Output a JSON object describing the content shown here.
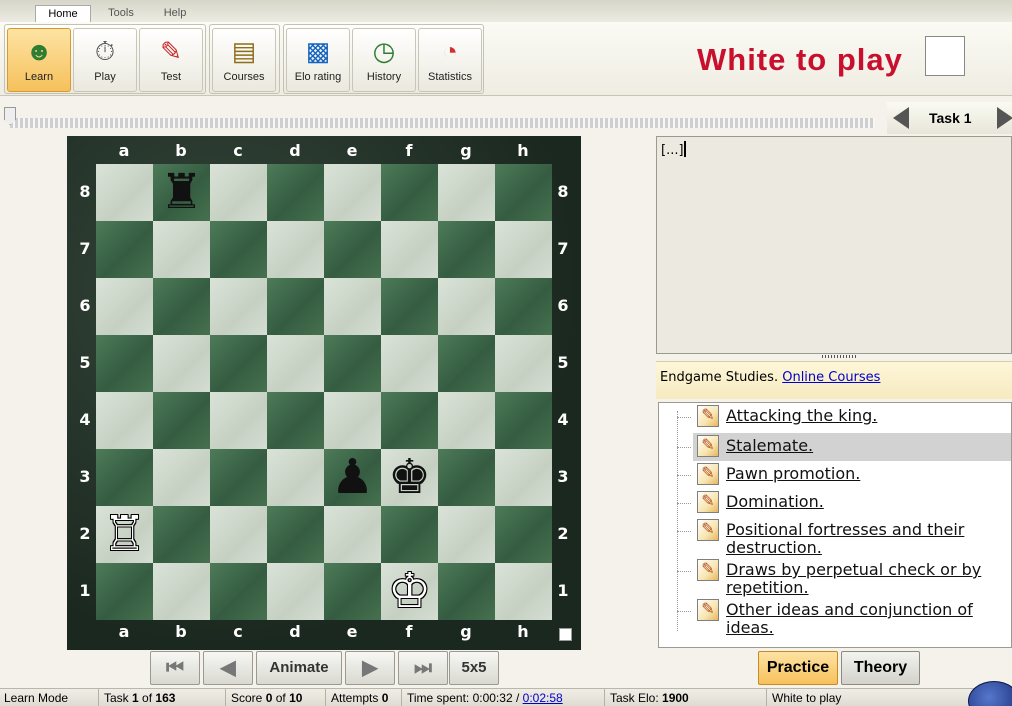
{
  "menu": {
    "tabs": [
      "Home",
      "Tools",
      "Help"
    ]
  },
  "ribbon": {
    "buttons": [
      {
        "label": "Learn",
        "icon": "learn-icon",
        "active": true
      },
      {
        "label": "Play",
        "icon": "chess-clock-icon",
        "active": false
      },
      {
        "label": "Test",
        "icon": "test-icon",
        "active": false
      },
      {
        "label": "Courses",
        "icon": "books-icon",
        "active": false
      },
      {
        "label": "Elo rating",
        "icon": "bar-chart-icon",
        "active": false
      },
      {
        "label": "History",
        "icon": "clock-history-icon",
        "active": false
      },
      {
        "label": "Statistics",
        "icon": "pie-chart-icon",
        "active": false
      }
    ]
  },
  "header": {
    "turn_text": "White to play"
  },
  "task_nav": {
    "label": "Task 1"
  },
  "board": {
    "files": [
      "a",
      "b",
      "c",
      "d",
      "e",
      "f",
      "g",
      "h"
    ],
    "ranks": [
      "8",
      "7",
      "6",
      "5",
      "4",
      "3",
      "2",
      "1"
    ],
    "pieces": [
      {
        "square": "b8",
        "glyph": "♜",
        "color": "black",
        "name": "black-rook"
      },
      {
        "square": "e3",
        "glyph": "♟",
        "color": "black",
        "name": "black-pawn"
      },
      {
        "square": "f3",
        "glyph": "♚",
        "color": "black",
        "name": "black-king"
      },
      {
        "square": "a2",
        "glyph": "♖",
        "color": "white",
        "name": "white-rook"
      },
      {
        "square": "f1",
        "glyph": "♔",
        "color": "white",
        "name": "white-king"
      }
    ]
  },
  "controls": {
    "animate": "Animate",
    "size": "5x5"
  },
  "comment": {
    "text": "[...]"
  },
  "info": {
    "prefix": "Endgame Studies.",
    "link": "Online Courses"
  },
  "tree_items": [
    {
      "label": "Attacking the king.",
      "selected": false
    },
    {
      "label": "Stalemate.",
      "selected": true
    },
    {
      "label": "Pawn promotion.",
      "selected": false
    },
    {
      "label": "Domination.",
      "selected": false
    },
    {
      "label": "Positional fortresses and their destruction.",
      "selected": false
    },
    {
      "label": "Draws by perpetual check or by repetition.",
      "selected": false
    },
    {
      "label": "Other ideas and conjunction of ideas.",
      "selected": false
    }
  ],
  "modes": {
    "practice": "Practice",
    "theory": "Theory"
  },
  "status": {
    "mode": "Learn Mode",
    "task_prefix": "Task ",
    "task_num": "1",
    "task_mid": " of ",
    "task_total": "163",
    "score_prefix": "Score ",
    "score_val": "0",
    "score_mid": " of ",
    "score_total": "10",
    "attempts_prefix": "Attempts ",
    "attempts_val": "0",
    "time_prefix": "Time spent: ",
    "time_spent": "0:00:32",
    "time_sep": " / ",
    "time_limit": "0:02:58",
    "elo_prefix": "Task Elo: ",
    "elo_val": "1900",
    "turn": "White to play"
  },
  "colors": {
    "title_red": "#c8102e",
    "learn_active": "#f6c15c",
    "practice_active": "#f6c15c",
    "link_blue": "#0000cc"
  }
}
